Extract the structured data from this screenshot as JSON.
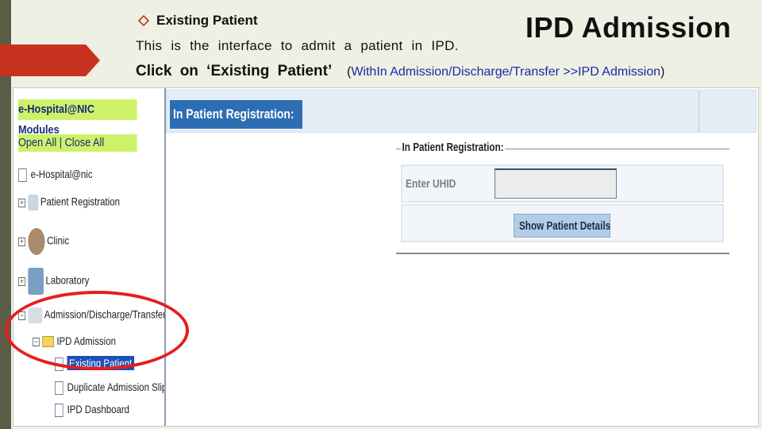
{
  "slide": {
    "bullet_text": "Existing Patient",
    "title": "IPD Admission",
    "description": "This is the interface to admit a patient in IPD.",
    "instruction": "Click on ‘Existing Patient’",
    "path_hint_open": "(",
    "path_hint": "WithIn Admission/Discharge/Transfer >>IPD Admission",
    "path_hint_close": ")",
    "accent_color": "#c8331f",
    "path_color": "#1a2aa8"
  },
  "nav": {
    "header": "e-Hospital@NIC Modules",
    "toggle_all": "Open All | Close All",
    "items": [
      {
        "label": "e-Hospital@nic"
      },
      {
        "label": "Patient Registration"
      },
      {
        "label": "Clinic"
      },
      {
        "label": "Laboratory"
      },
      {
        "label": "Admission/Discharge/Transfer"
      },
      {
        "label": "IPD Admission"
      },
      {
        "label": "Existing Patient"
      },
      {
        "label": "Duplicate Admission Slip"
      },
      {
        "label": "IPD Dashboard"
      }
    ]
  },
  "form": {
    "page_title": "In Patient Registration:",
    "fieldset_legend": "In Patient Registration:",
    "uhid_label": "Enter UHID",
    "uhid_value": "",
    "submit_label": "Show Patient Details"
  }
}
